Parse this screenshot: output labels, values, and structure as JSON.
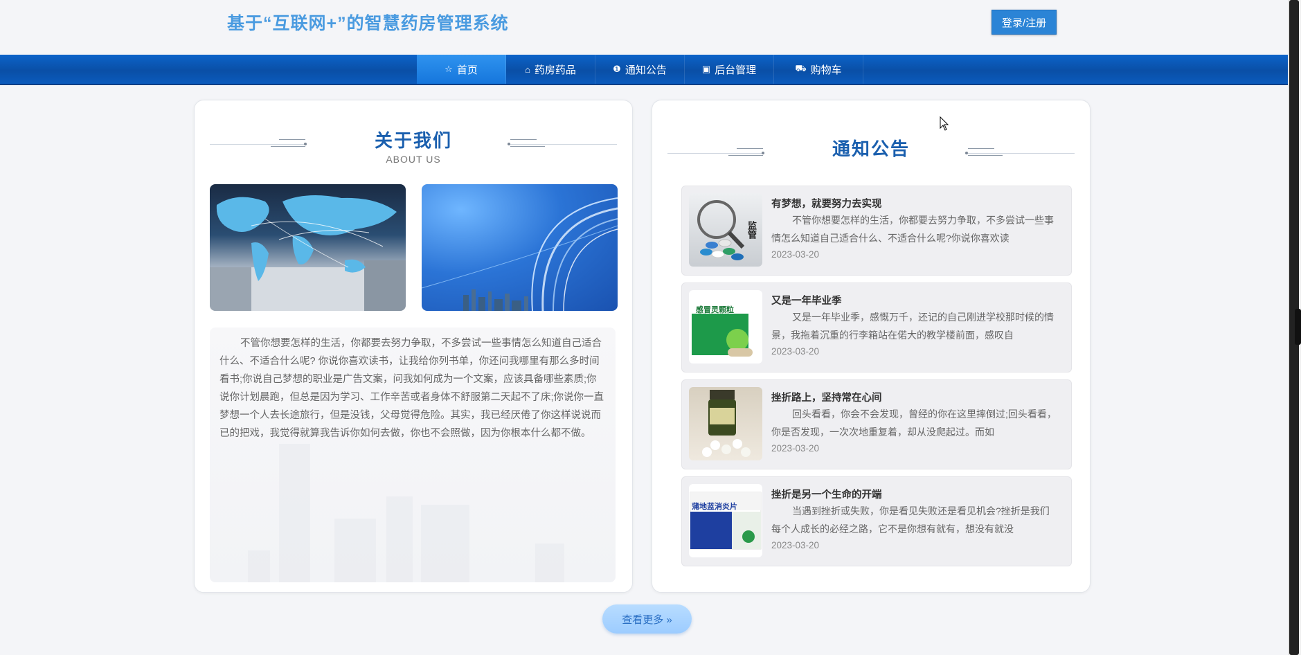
{
  "header": {
    "title": "基于“互联网+”的智慧药房管理系统",
    "login_label": "登录/注册"
  },
  "nav": {
    "items": [
      {
        "label": "首页",
        "icon": "star-icon",
        "glyph": "☆"
      },
      {
        "label": "药房药品",
        "icon": "bag-icon",
        "glyph": "⌂"
      },
      {
        "label": "通知公告",
        "icon": "info-icon",
        "glyph": "❶"
      },
      {
        "label": "后台管理",
        "icon": "briefcase-icon",
        "glyph": "▣"
      },
      {
        "label": "购物车",
        "icon": "cart-icon",
        "glyph": "⛟"
      }
    ]
  },
  "about": {
    "title": "关于我们",
    "subtitle": "ABOUT US",
    "text": "不管你想要怎样的生活，你都要去努力争取，不多尝试一些事情怎么知道自己适合什么、不适合什么呢? 你说你喜欢读书，让我给你列书单，你还问我哪里有那么多时间看书;你说自己梦想的职业是广告文案，问我如何成为一个文案，应该具备哪些素质;你说你计划晨跑，但总是因为学习、工作辛苦或者身体不舒服第二天起不了床;你说你一直梦想一个人去长途旅行，但是没钱，父母觉得危险。其实，我已经厌倦了你这样说说而已的把戏，我觉得就算我告诉你如何去做，你也不会照做，因为你根本什么都不做。"
  },
  "notices": {
    "title": "通知公告",
    "items": [
      {
        "title": "有梦想，就要努力去实现",
        "body": "不管你想要怎样的生活，你都要去努力争取，不多尝试一些事情怎么知道自己适合什么、不适合什么呢?你说你喜欢读",
        "date": "2023-03-20",
        "thumb_text": "监管"
      },
      {
        "title": "又是一年毕业季",
        "body": "又是一年毕业季，感慨万千，还记的自己刚进学校那时候的情景，我拖着沉重的行李箱站在偌大的教学楼前面，感叹自",
        "date": "2023-03-20",
        "thumb_text": "感冒灵颗粒"
      },
      {
        "title": "挫折路上，坚持常在心间",
        "body": "回头看看，你会不会发现，曾经的你在这里摔倒过;回头看看，你是否发现，一次次地重复着，却从没爬起过。而如",
        "date": "2023-03-20",
        "thumb_text": ""
      },
      {
        "title": "挫折是另一个生命的开端",
        "body": "当遇到挫折或失败，你是看见失败还是看见机会?挫折是我们每个人成长的必经之路，它不是你想有就有，想没有就没",
        "date": "2023-03-20",
        "thumb_text": "蒲地蓝消炎片"
      }
    ],
    "more_label": "查看更多 »"
  }
}
